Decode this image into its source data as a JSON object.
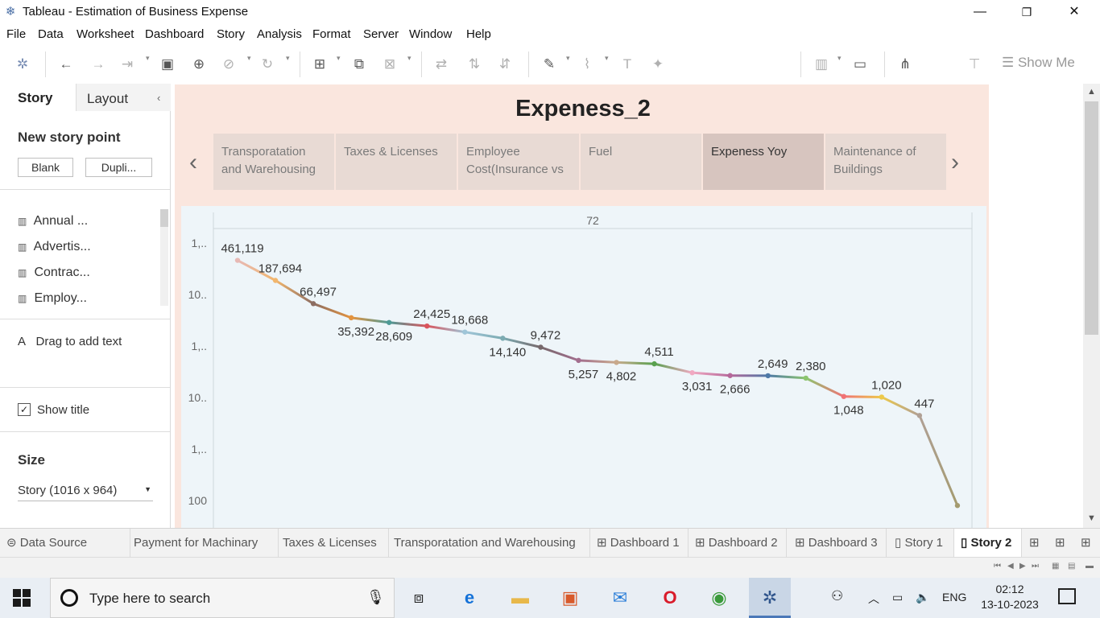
{
  "window": {
    "title": "Tableau - Estimation of Business Expense",
    "minimize": "—",
    "maximize": "❐",
    "close": "✕"
  },
  "menu": [
    "File",
    "Data",
    "Worksheet",
    "Dashboard",
    "Story",
    "Analysis",
    "Format",
    "Server",
    "Window",
    "Help"
  ],
  "toolbar": {
    "show_me": "Show Me"
  },
  "left_pane": {
    "tabs": {
      "story": "Story",
      "layout": "Layout"
    },
    "new_story_point": "New story point",
    "blank_button": "Blank",
    "duplicate_button": "Dupli...",
    "sheets": [
      "Annual ...",
      "Advertis...",
      "Contrac...",
      "Employ..."
    ],
    "drag_text_icon": "A",
    "drag_text": "Drag to add text",
    "show_title_label": "Show title",
    "show_title_checked": true,
    "size_heading": "Size",
    "size_value": "Story (1016 x 964)"
  },
  "story": {
    "title": "Expeness_2",
    "points": [
      {
        "label": "Transporatation and Warehousing",
        "active": false
      },
      {
        "label": "Taxes & Licenses",
        "active": false
      },
      {
        "label": "Employee Cost(Insurance vs",
        "active": false
      },
      {
        "label": "Fuel",
        "active": false
      },
      {
        "label": "Expeness Yoy",
        "active": true
      },
      {
        "label": "Maintenance of Buildings",
        "active": false
      }
    ]
  },
  "chart_data": {
    "type": "line",
    "title": "",
    "header": "72",
    "y_scale": "log",
    "y_tick_labels": [
      "1,..",
      "10..",
      "1,..",
      "10..",
      "1,..",
      "100"
    ],
    "y_tick_values": [
      1000000,
      100000,
      10000,
      1000,
      100,
      10
    ],
    "values": [
      461119,
      187694,
      66497,
      35392,
      28609,
      24425,
      18668,
      14140,
      9472,
      5257,
      4802,
      4511,
      3031,
      2666,
      2649,
      2380,
      1048,
      1020,
      447,
      8
    ],
    "label_positions": [
      "above",
      "above",
      "above",
      "below",
      "below",
      "above",
      "above",
      "below",
      "above",
      "below",
      "below",
      "above",
      "below",
      "below",
      "above",
      "above",
      "below",
      "above",
      "above",
      "none"
    ],
    "colors": [
      "#e7b9b5",
      "#f2b66d",
      "#8c6d62",
      "#e3933f",
      "#4e9a96",
      "#d9545c",
      "#9fc5d8",
      "#7cabb2",
      "#76686b",
      "#a36e8e",
      "#c8a98c",
      "#59a14f",
      "#f0a9c2",
      "#b5689a",
      "#4e79a7",
      "#8cc56f",
      "#f07275",
      "#edc94a",
      "#b0a095",
      "#a49b70"
    ],
    "grid": false,
    "legend": "none"
  },
  "sheet_tabs": [
    {
      "label": "Data Source",
      "icon": "database",
      "active": false
    },
    {
      "label": "Payment for Machinary",
      "icon": "",
      "active": false
    },
    {
      "label": "Taxes & Licenses",
      "icon": "",
      "active": false
    },
    {
      "label": "Transporatation and Warehousing",
      "icon": "",
      "active": false
    },
    {
      "label": "Dashboard 1",
      "icon": "dashboard",
      "active": false
    },
    {
      "label": "Dashboard 2",
      "icon": "dashboard",
      "active": false
    },
    {
      "label": "Dashboard 3",
      "icon": "dashboard",
      "active": false
    },
    {
      "label": "Story 1",
      "icon": "story",
      "active": false
    },
    {
      "label": "Story 2",
      "icon": "story",
      "active": true
    }
  ],
  "taskbar": {
    "search_placeholder": "Type here to search",
    "language": "ENG",
    "time": "02:12",
    "date": "13-10-2023"
  }
}
